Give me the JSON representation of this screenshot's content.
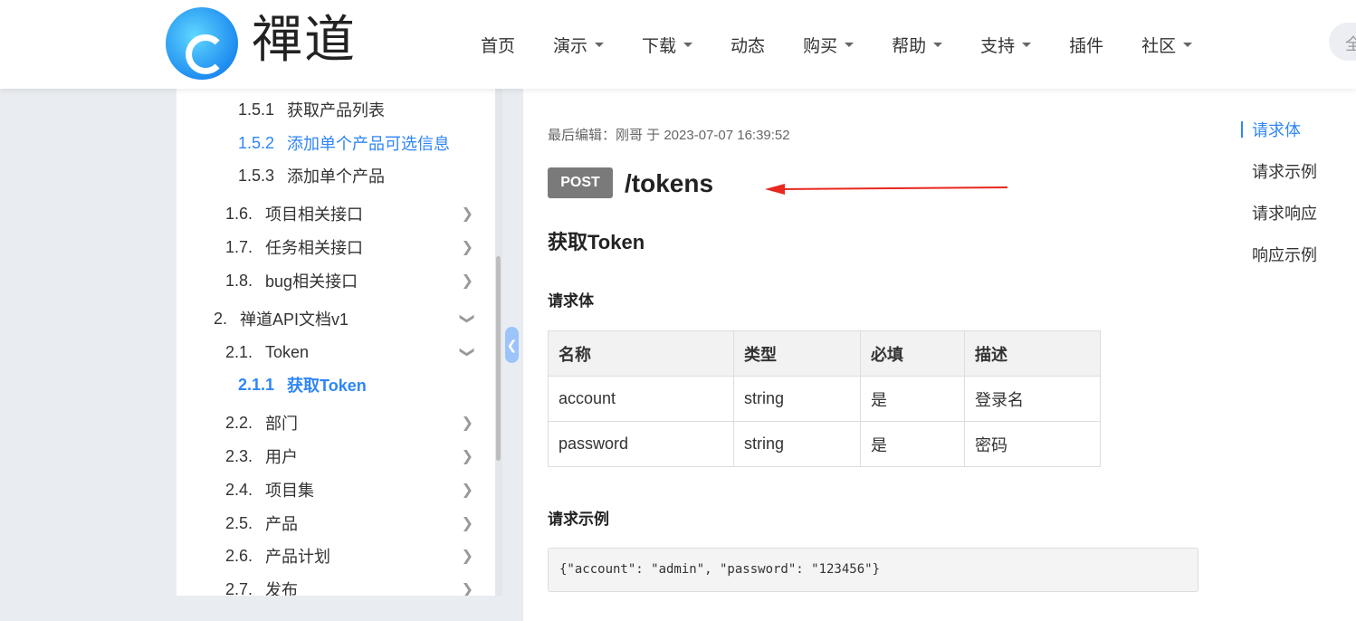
{
  "header": {
    "logo_text": "禪道",
    "nav": [
      {
        "label": "首页",
        "dropdown": false
      },
      {
        "label": "演示",
        "dropdown": true
      },
      {
        "label": "下载",
        "dropdown": true
      },
      {
        "label": "动态",
        "dropdown": false
      },
      {
        "label": "购买",
        "dropdown": true
      },
      {
        "label": "帮助",
        "dropdown": true
      },
      {
        "label": "支持",
        "dropdown": true
      },
      {
        "label": "插件",
        "dropdown": false
      },
      {
        "label": "社区",
        "dropdown": true
      }
    ],
    "search_text": "全"
  },
  "sidebar": {
    "items": [
      {
        "num": "1.5.1",
        "label": "获取产品列表"
      },
      {
        "num": "1.5.2",
        "label": "添加单个产品可选信息"
      },
      {
        "num": "1.5.3",
        "label": "添加单个产品"
      },
      {
        "num": "1.6.",
        "label": "项目相关接口"
      },
      {
        "num": "1.7.",
        "label": "任务相关接口"
      },
      {
        "num": "1.8.",
        "label": "bug相关接口"
      },
      {
        "num": "2.",
        "label": "禅道API文档v1"
      },
      {
        "num": "2.1.",
        "label": "Token"
      },
      {
        "num": "2.1.1",
        "label": "获取Token"
      },
      {
        "num": "2.2.",
        "label": "部门"
      },
      {
        "num": "2.3.",
        "label": "用户"
      },
      {
        "num": "2.4.",
        "label": "项目集"
      },
      {
        "num": "2.5.",
        "label": "产品"
      },
      {
        "num": "2.6.",
        "label": "产品计划"
      },
      {
        "num": "2.7.",
        "label": "发布"
      }
    ]
  },
  "main": {
    "meta": "最后编辑：刚哥 于 2023-07-07 16:39:52",
    "method": "POST",
    "path": "/tokens",
    "title": "获取Token",
    "request_body_heading": "请求体",
    "table": {
      "headers": [
        "名称",
        "类型",
        "必填",
        "描述"
      ],
      "rows": [
        [
          "account",
          "string",
          "是",
          "登录名"
        ],
        [
          "password",
          "string",
          "是",
          "密码"
        ]
      ]
    },
    "example_heading": "请求示例",
    "example_code": "{\"account\": \"admin\", \"password\": \"123456\"}"
  },
  "toc": [
    "请求体",
    "请求示例",
    "请求响应",
    "响应示例"
  ],
  "colors": {
    "accent": "#2f86f6",
    "method_badge": "#7a7a7a",
    "arrow": "#e8271f"
  }
}
